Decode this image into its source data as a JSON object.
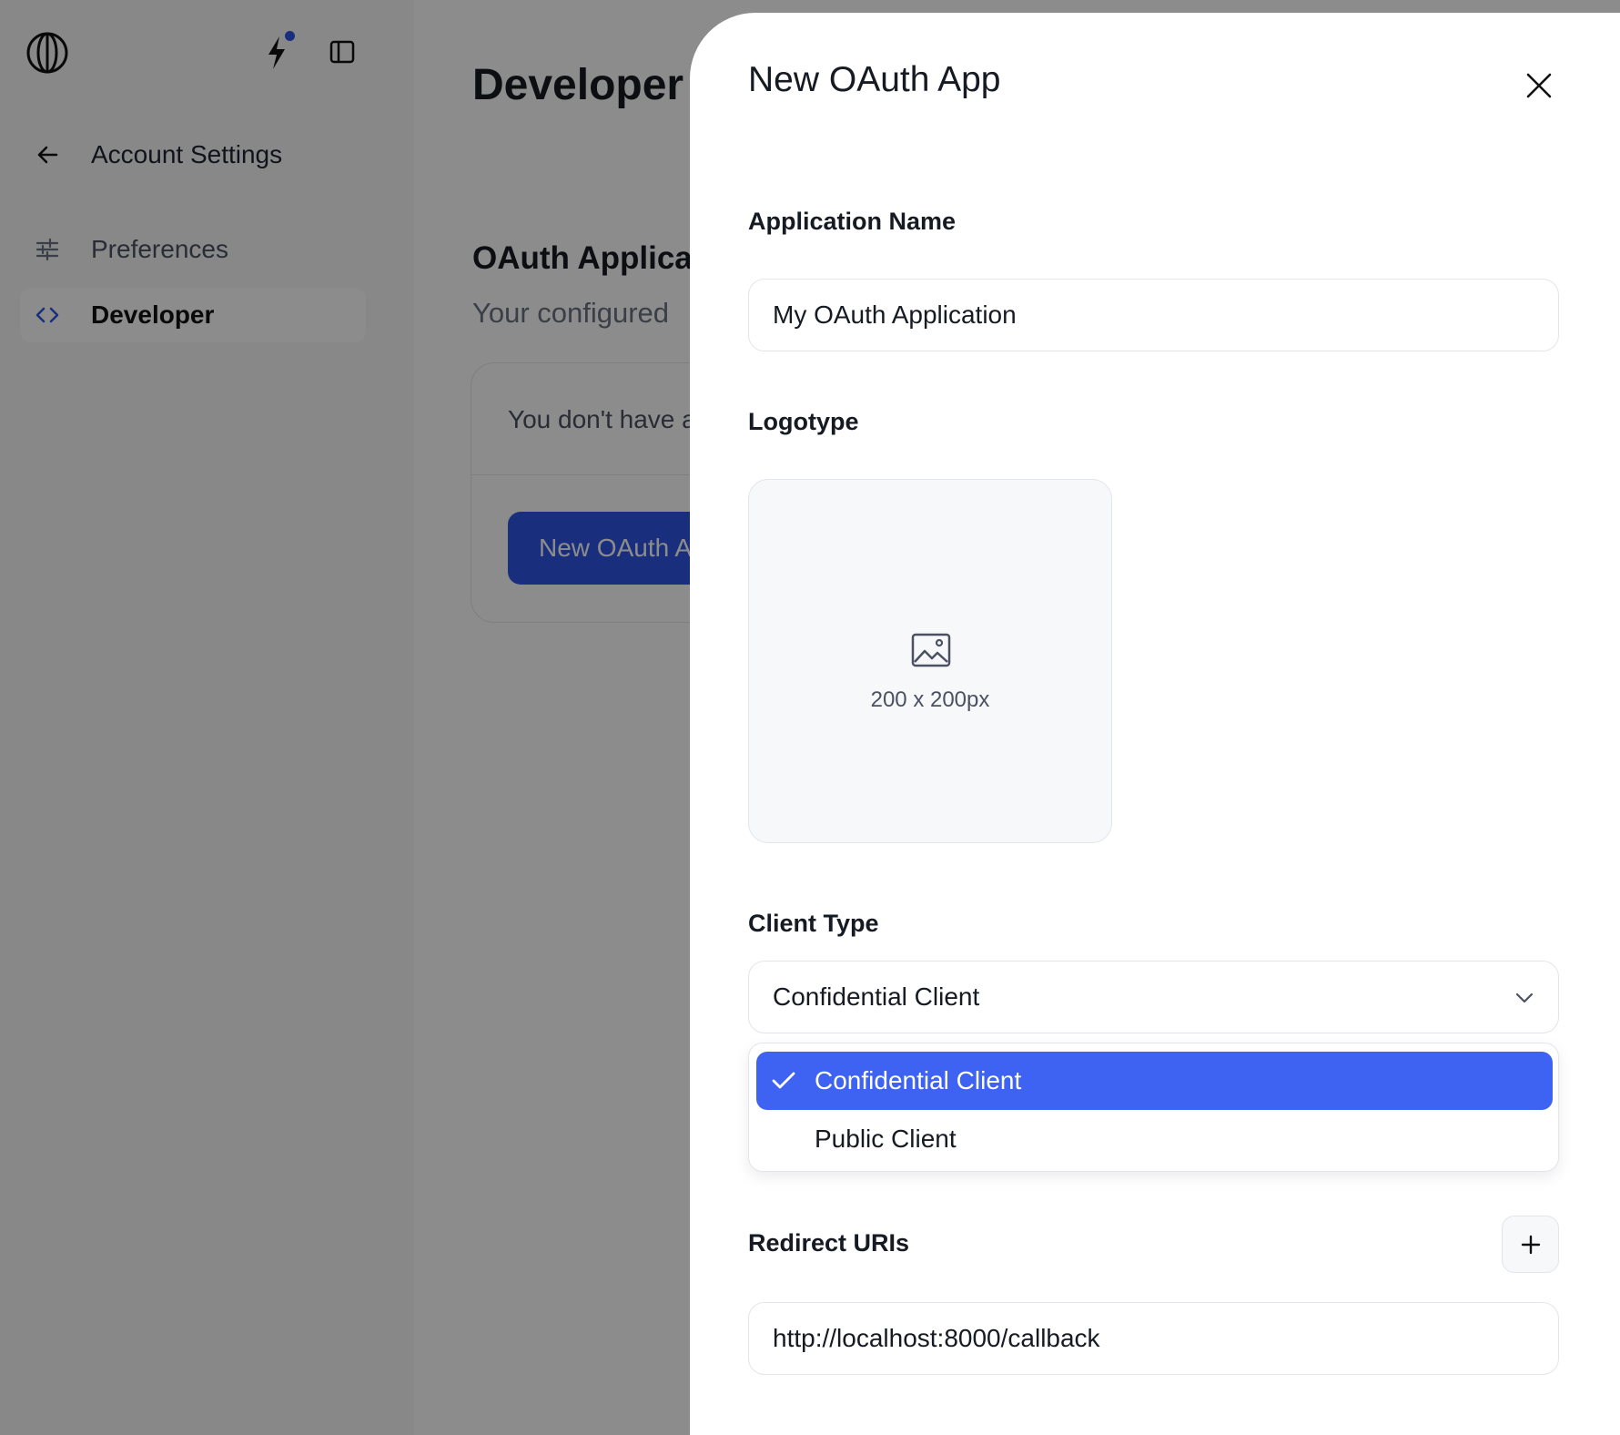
{
  "sidebar": {
    "back_label": "Account Settings",
    "items": [
      {
        "label": "Preferences",
        "icon": "sliders-icon"
      },
      {
        "label": "Developer",
        "icon": "code-icon",
        "active": true
      }
    ]
  },
  "page": {
    "title": "Developer",
    "section_title": "OAuth Applica",
    "section_subtitle": "Your configured",
    "empty_text": "You don't have a",
    "new_button_label": "New OAuth A"
  },
  "modal": {
    "title": "New OAuth App",
    "application_name": {
      "label": "Application Name",
      "value": "My OAuth Application"
    },
    "logotype": {
      "label": "Logotype",
      "size_hint": "200 x 200px"
    },
    "client_type": {
      "label": "Client Type",
      "selected": "Confidential Client",
      "options": [
        "Confidential Client",
        "Public Client"
      ]
    },
    "redirect_uris": {
      "label": "Redirect URIs",
      "values": [
        "http://localhost:8000/callback"
      ]
    }
  },
  "colors": {
    "accent": "#2f57e6",
    "selected_option": "#3e63f2",
    "overlay": "rgba(0,0,0,0.45)"
  }
}
